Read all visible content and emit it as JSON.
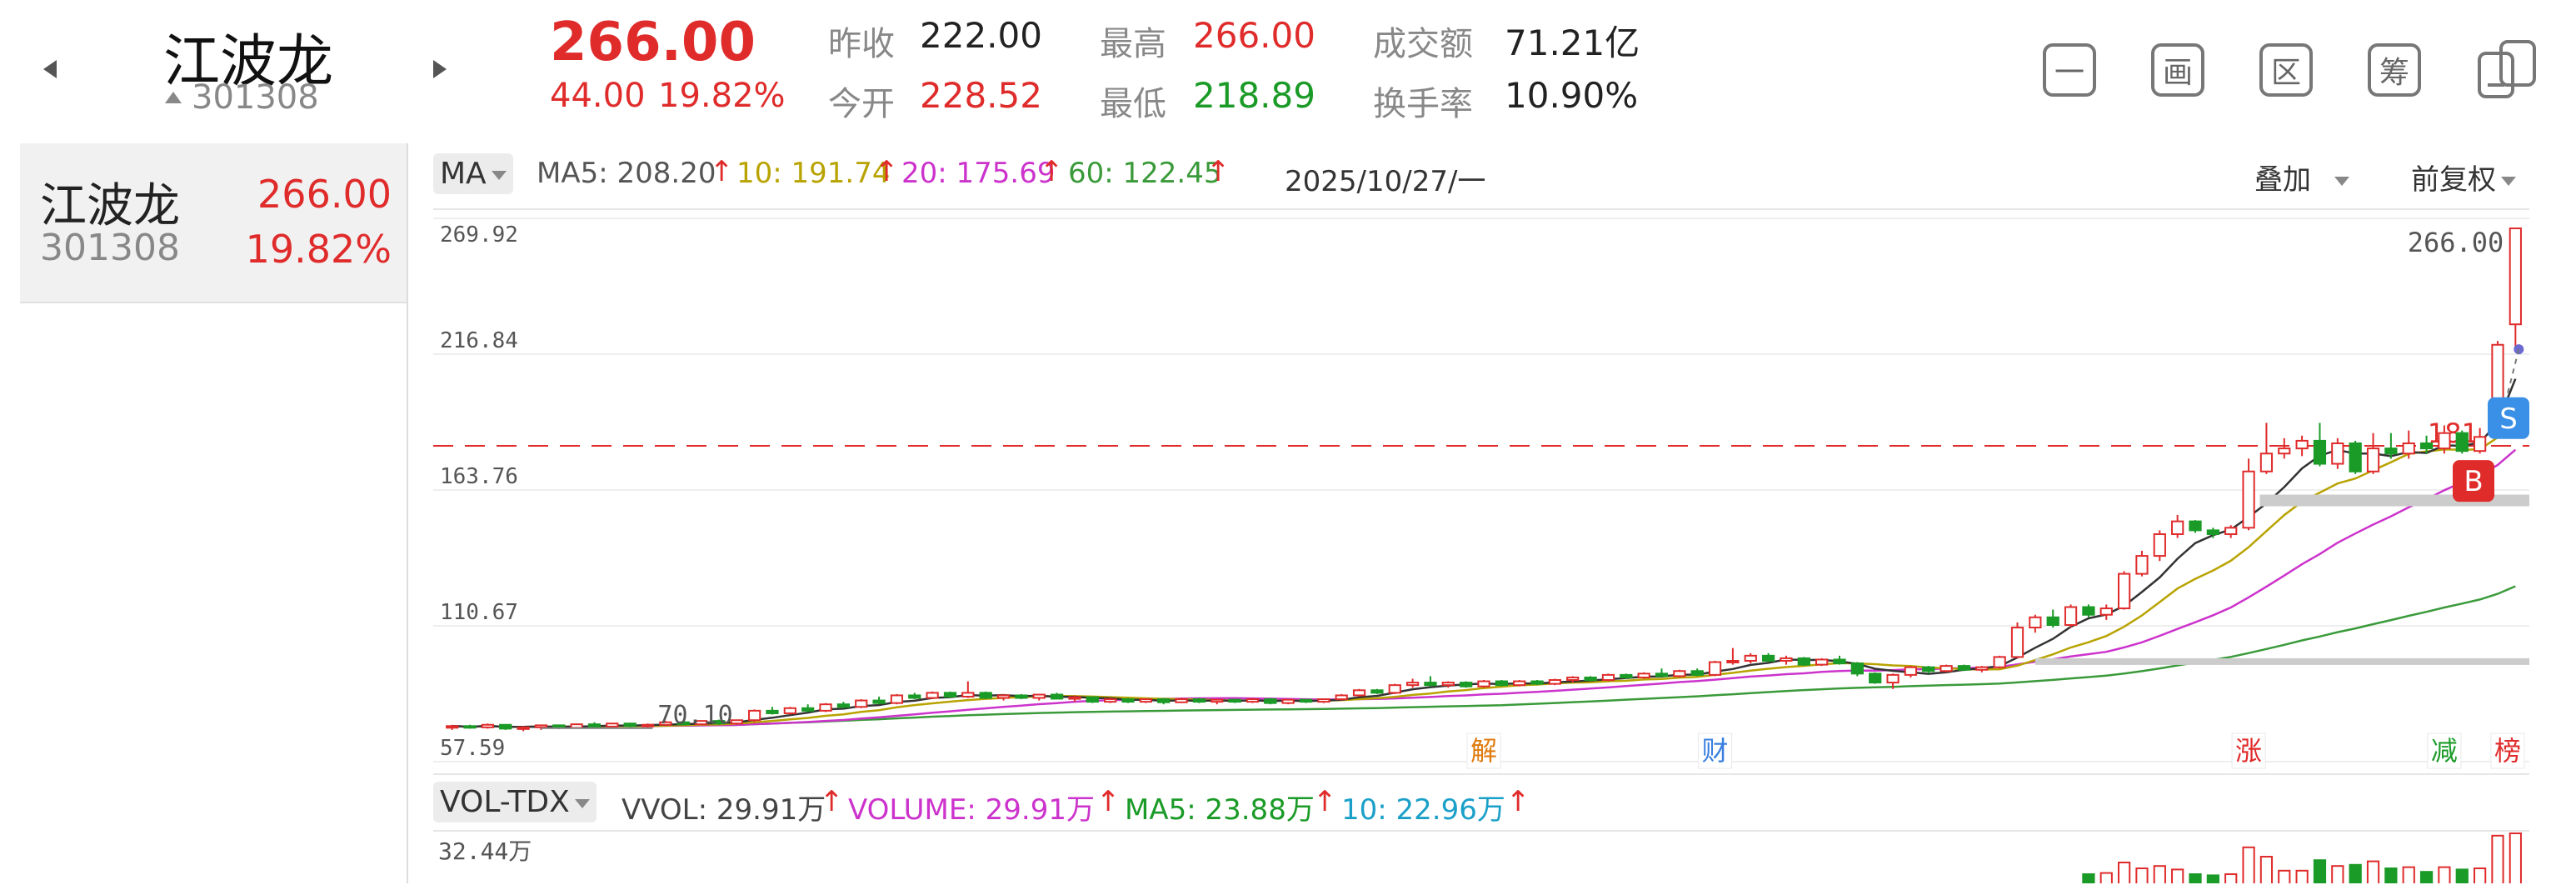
{
  "header": {
    "stock_name": "江波龙",
    "stock_code": "301308",
    "price": "266.00",
    "change_abs": "44.00",
    "change_pct": "19.82%",
    "stats": [
      {
        "label": "昨收",
        "value": "222.00",
        "color": "dark"
      },
      {
        "label": "今开",
        "value": "228.52",
        "color": "red"
      },
      {
        "label": "最高",
        "value": "266.00",
        "color": "red"
      },
      {
        "label": "最低",
        "value": "218.89",
        "color": "green"
      },
      {
        "label": "成交额",
        "value": "71.21亿",
        "color": "dark"
      },
      {
        "label": "换手率",
        "value": "10.90%",
        "color": "dark"
      }
    ],
    "tool_icons": [
      "minimize-icon",
      "picture-icon",
      "region-icon",
      "chip-icon",
      "device-switch-icon"
    ],
    "tool_glyphs": [
      "一",
      "画",
      "区",
      "筹",
      ""
    ]
  },
  "left_list": {
    "items": [
      {
        "name": "江波龙",
        "code": "301308",
        "price": "266.00",
        "pct": "19.82%"
      }
    ]
  },
  "chart_header": {
    "indicator": "MA",
    "ma5": "MA5: 208.20",
    "ma10": "10: 191.74",
    "ma20": "20: 175.69",
    "ma60": "60: 122.45",
    "date": "2025/10/27/一",
    "overlay": "叠加",
    "adjust": "前复权"
  },
  "colors": {
    "up": "#e02b2b",
    "down": "#1a9a26",
    "ma5": "#333333",
    "ma10": "#b8a300",
    "ma20": "#cc33cc",
    "ma60": "#3a9a3a",
    "buy": "#e02b2b",
    "sell": "#3a8fe6",
    "event_jie": "#e07b10",
    "event_cai": "#3a7fe0",
    "event_zhang": "#e02b2b",
    "event_jian": "#1a9a26",
    "event_bang": "#e02b2b"
  },
  "chart_data": {
    "type": "candlestick",
    "y_axis_ticks": [
      "269.92",
      "216.84",
      "163.76",
      "110.67",
      "57.59"
    ],
    "ylim": [
      57.59,
      269.92
    ],
    "last_price_label": "266.00",
    "low_marker_label": "70.10",
    "ref_line_label": "181",
    "ref_line_value": 181,
    "events": [
      "解",
      "财",
      "涨",
      "减",
      "榜"
    ],
    "trade_markers": [
      "S",
      "B"
    ],
    "candles": [
      [
        71,
        72,
        70,
        71.5
      ],
      [
        71.5,
        72,
        70.5,
        71
      ],
      [
        71,
        72.5,
        70.5,
        72
      ],
      [
        72,
        72,
        70,
        70.5
      ],
      [
        70.5,
        71.5,
        69.5,
        71
      ],
      [
        71,
        72,
        70,
        71.8
      ],
      [
        71.8,
        72,
        70.3,
        70.8
      ],
      [
        70.8,
        72.5,
        70.5,
        72.2
      ],
      [
        72.2,
        73,
        71,
        71.3
      ],
      [
        71.3,
        72.8,
        71,
        72.5
      ],
      [
        72.5,
        72.8,
        71,
        71.5
      ],
      [
        71.5,
        72.5,
        70.8,
        72
      ],
      [
        72,
        73.5,
        71.5,
        73
      ],
      [
        73,
        73.5,
        71.8,
        72.2
      ],
      [
        72.2,
        73.8,
        72,
        73.5
      ],
      [
        73.5,
        74,
        72,
        72.5
      ],
      [
        72.5,
        74,
        72,
        73.8
      ],
      [
        73.8,
        78,
        73,
        77.5
      ],
      [
        77.5,
        79,
        76,
        76.5
      ],
      [
        76.5,
        79,
        76,
        78.5
      ],
      [
        78.5,
        80,
        77,
        77.5
      ],
      [
        77.5,
        80.5,
        77,
        80
      ],
      [
        80,
        81,
        78.5,
        79
      ],
      [
        79,
        82,
        78.5,
        81.5
      ],
      [
        81.5,
        83,
        80,
        80.5
      ],
      [
        80.5,
        84,
        80,
        83.5
      ],
      [
        83.5,
        84.5,
        82,
        82.5
      ],
      [
        82.5,
        85,
        82,
        84.5
      ],
      [
        84.5,
        85,
        82.5,
        83
      ],
      [
        83,
        89,
        82.5,
        84.5
      ],
      [
        84.5,
        85,
        82,
        82.5
      ],
      [
        82.5,
        84,
        81.5,
        83.5
      ],
      [
        83.5,
        84,
        82,
        82.5
      ],
      [
        82.5,
        84,
        81.5,
        83.8
      ],
      [
        83.8,
        84.5,
        82,
        82.2
      ],
      [
        82.2,
        83.5,
        81,
        82.8
      ],
      [
        82.8,
        83,
        80.5,
        81
      ],
      [
        81,
        82.5,
        80.5,
        82
      ],
      [
        82,
        82.5,
        80.5,
        81
      ],
      [
        81,
        82.3,
        80.5,
        82
      ],
      [
        82,
        82.5,
        80,
        80.8
      ],
      [
        80.8,
        82.5,
        80.5,
        82
      ],
      [
        82,
        82.5,
        80.5,
        81
      ],
      [
        81,
        82,
        80,
        81.8
      ],
      [
        81.8,
        82,
        80.5,
        81
      ],
      [
        81,
        82.5,
        80.5,
        82
      ],
      [
        82,
        82.5,
        80,
        80.5
      ],
      [
        80.5,
        82,
        80,
        81.8
      ],
      [
        81.8,
        82,
        80.5,
        81
      ],
      [
        81,
        82.2,
        80.5,
        82
      ],
      [
        82,
        84,
        81.5,
        83.5
      ],
      [
        83.5,
        86,
        83,
        85.5
      ],
      [
        85.5,
        86,
        84,
        84.5
      ],
      [
        84.5,
        88,
        84,
        87.5
      ],
      [
        87.5,
        90,
        86.5,
        88.5
      ],
      [
        88.5,
        91,
        87,
        87.5
      ],
      [
        87.5,
        89,
        86.5,
        88.5
      ],
      [
        88.5,
        89,
        86.5,
        87
      ],
      [
        87,
        89.5,
        86.5,
        89
      ],
      [
        89,
        89.5,
        87,
        87.5
      ],
      [
        87.5,
        89.5,
        87,
        89
      ],
      [
        89,
        89.5,
        87.5,
        88
      ],
      [
        88,
        90,
        87.5,
        89.5
      ],
      [
        89.5,
        91,
        88.5,
        90.5
      ],
      [
        90.5,
        91,
        89,
        89.5
      ],
      [
        89.5,
        92,
        89,
        91.5
      ],
      [
        91.5,
        92,
        90,
        90.5
      ],
      [
        90.5,
        92.5,
        90,
        92
      ],
      [
        92,
        94,
        91.5,
        91
      ],
      [
        91,
        93.5,
        90.5,
        93
      ],
      [
        93,
        94,
        91,
        91.5
      ],
      [
        91.5,
        97,
        91,
        96.5
      ],
      [
        96.5,
        102,
        95.5,
        97
      ],
      [
        97,
        100,
        96,
        99
      ],
      [
        99,
        100,
        96.5,
        97
      ],
      [
        97,
        99,
        95.5,
        98
      ],
      [
        98,
        98.5,
        95,
        95.5
      ],
      [
        95.5,
        98,
        95,
        97.5
      ],
      [
        97.5,
        99,
        95.5,
        96
      ],
      [
        96,
        96.5,
        91,
        92
      ],
      [
        92,
        92.5,
        88,
        88.5
      ],
      [
        88.5,
        92,
        86,
        91.5
      ],
      [
        91.5,
        95,
        90.5,
        94.5
      ],
      [
        94.5,
        95,
        92,
        93
      ],
      [
        93,
        95.5,
        92.5,
        95
      ],
      [
        95,
        95.5,
        93,
        93.5
      ],
      [
        93.5,
        95,
        92.5,
        94.5
      ],
      [
        94.5,
        99,
        94,
        98.5
      ],
      [
        98.5,
        112,
        98,
        110
      ],
      [
        110,
        115,
        108,
        114
      ],
      [
        114,
        117,
        110,
        111
      ],
      [
        111,
        119,
        110,
        118
      ],
      [
        118,
        119,
        114,
        115
      ],
      [
        115,
        119,
        113,
        117.5
      ],
      [
        117.5,
        132,
        117,
        131
      ],
      [
        131,
        140,
        130,
        138
      ],
      [
        138,
        148,
        136,
        146.5
      ],
      [
        146.5,
        154,
        145,
        151.5
      ],
      [
        151.5,
        152,
        147,
        148
      ],
      [
        148,
        149,
        145,
        146.5
      ],
      [
        146.5,
        150,
        145,
        149
      ],
      [
        149,
        176,
        148,
        171
      ],
      [
        171,
        190,
        170,
        178
      ],
      [
        178,
        184,
        176,
        180
      ],
      [
        180,
        185,
        177,
        183
      ],
      [
        183,
        190,
        173,
        174
      ],
      [
        174,
        184,
        172,
        182
      ],
      [
        182,
        183,
        170,
        171
      ],
      [
        171,
        186,
        170,
        180
      ],
      [
        180,
        186,
        176,
        178
      ],
      [
        178,
        187,
        176,
        182
      ],
      [
        182,
        185,
        178,
        180
      ],
      [
        180,
        189,
        178,
        186
      ],
      [
        186,
        187,
        178,
        179
      ],
      [
        179,
        188,
        178,
        184.5
      ],
      [
        184.5,
        222,
        184,
        220.5
      ],
      [
        228.5,
        266,
        218.9,
        266
      ]
    ]
  },
  "volume_header": {
    "indicator": "VOL-TDX",
    "vvol": "VVOL: 29.91万",
    "volume": "VOLUME: 29.91万",
    "ma5": "MA5: 23.88万",
    "ma10": "10: 22.96万",
    "max_label": "32.44万"
  }
}
